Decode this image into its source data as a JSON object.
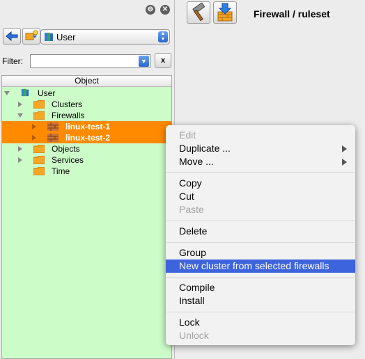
{
  "panel": {
    "restore_glyph": "⊖",
    "close_glyph": "✕"
  },
  "library_select": {
    "value": "User"
  },
  "filter": {
    "label": "Filter:",
    "value": "",
    "placeholder": "",
    "clear_label": "x"
  },
  "tree": {
    "header": "Object",
    "items": [
      {
        "label": "User",
        "level": 0,
        "expanded": true,
        "icon": "library-icon",
        "selected": false
      },
      {
        "label": "Clusters",
        "level": 1,
        "expanded": false,
        "icon": "folder-icon",
        "selected": false
      },
      {
        "label": "Firewalls",
        "level": 1,
        "expanded": true,
        "icon": "folder-icon",
        "selected": false
      },
      {
        "label": "linux-test-1",
        "level": 2,
        "expanded": false,
        "icon": "firewall-icon",
        "selected": true
      },
      {
        "label": "linux-test-2",
        "level": 2,
        "expanded": false,
        "icon": "firewall-icon",
        "selected": true
      },
      {
        "label": "Objects",
        "level": 1,
        "expanded": false,
        "icon": "folder-icon",
        "selected": false
      },
      {
        "label": "Services",
        "level": 1,
        "expanded": false,
        "icon": "folder-icon",
        "selected": false
      },
      {
        "label": "Time",
        "level": 1,
        "expanded": null,
        "icon": "folder-icon",
        "selected": false
      }
    ]
  },
  "editor": {
    "title": "Firewall / ruleset"
  },
  "context_menu": {
    "items": [
      {
        "label": "Edit",
        "disabled": true
      },
      {
        "label": "Duplicate ...",
        "submenu": true
      },
      {
        "label": "Move ...",
        "submenu": true
      },
      {
        "label": "Copy"
      },
      {
        "label": "Cut"
      },
      {
        "label": "Paste",
        "disabled": true
      },
      {
        "label": "Delete"
      },
      {
        "label": "Group"
      },
      {
        "label": "New cluster from selected firewalls",
        "highlighted": true
      },
      {
        "label": "Compile"
      },
      {
        "label": "Install"
      },
      {
        "label": "Lock"
      },
      {
        "label": "Unlock",
        "disabled": true
      }
    ]
  },
  "colors": {
    "tree_background": "#ccfdc9",
    "selection": "#ff8a00",
    "menu_highlight": "#3d64dc",
    "folder": "#f5a623"
  }
}
